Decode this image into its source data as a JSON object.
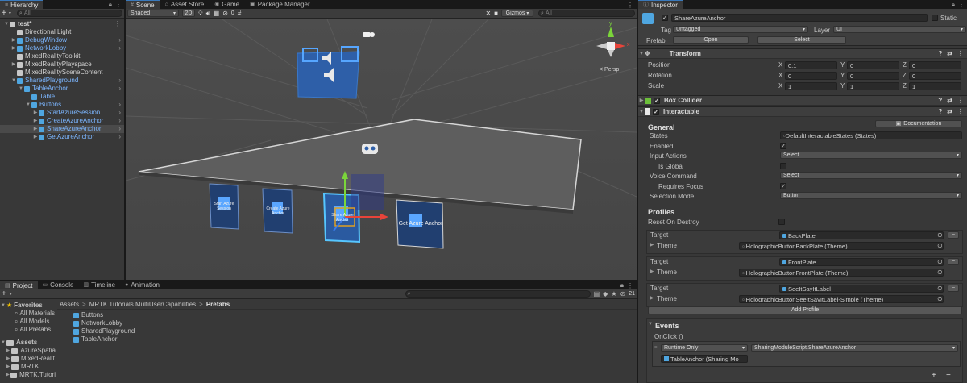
{
  "hierarchy": {
    "tab": "Hierarchy",
    "search_placeholder": "All",
    "items": [
      {
        "label": "test*",
        "blue": false,
        "arrow": "▼",
        "icon": "unity-scene"
      },
      {
        "label": "Directional Light",
        "blue": false,
        "arrow": "",
        "icon": "cube"
      },
      {
        "label": "DebugWindow",
        "blue": true,
        "arrow": "▶",
        "icon": "prefab"
      },
      {
        "label": "NetworkLobby",
        "blue": true,
        "arrow": "▶",
        "icon": "prefab"
      },
      {
        "label": "MixedRealityToolkit",
        "blue": false,
        "arrow": "",
        "icon": "cube"
      },
      {
        "label": "MixedRealityPlayspace",
        "blue": false,
        "arrow": "▶",
        "icon": "cube"
      },
      {
        "label": "MixedRealitySceneContent",
        "blue": false,
        "arrow": "",
        "icon": "cube"
      },
      {
        "label": "SharedPlayground",
        "blue": true,
        "arrow": "▼",
        "icon": "prefab"
      },
      {
        "label": "TableAnchor",
        "blue": true,
        "arrow": "▼",
        "icon": "prefab"
      },
      {
        "label": "Table",
        "blue": true,
        "arrow": "",
        "icon": "prefab"
      },
      {
        "label": "Buttons",
        "blue": true,
        "arrow": "▼",
        "icon": "prefab"
      },
      {
        "label": "StartAzureSession",
        "blue": true,
        "arrow": "▶",
        "icon": "prefab"
      },
      {
        "label": "CreateAzureAnchor",
        "blue": true,
        "arrow": "▶",
        "icon": "prefab"
      },
      {
        "label": "ShareAzureAnchor",
        "blue": true,
        "arrow": "▶",
        "icon": "prefab"
      },
      {
        "label": "GetAzureAnchor",
        "blue": true,
        "arrow": "▶",
        "icon": "prefab"
      }
    ]
  },
  "scene": {
    "tabs": [
      "Scene",
      "Asset Store",
      "Game",
      "Package Manager"
    ],
    "shading": "Shaded",
    "mode_2d": "2D",
    "hidden_count": "0",
    "gizmos": "Gizmos",
    "search_placeholder": "All",
    "persp_label": "< Persp",
    "axis_y": "y",
    "axis_x": "x",
    "panel_texts": [
      "Start Azure Session",
      "Create Azure Anchor",
      "Share Azure Anchor",
      "Get Azure Anchor"
    ]
  },
  "project": {
    "tabs": [
      "Project",
      "Console",
      "Timeline",
      "Animation"
    ],
    "search_placeholder": "",
    "hidden_count": "21",
    "favorites_label": "Favorites",
    "favorites": [
      "All Materials",
      "All Models",
      "All Prefabs"
    ],
    "assets_label": "Assets",
    "assets": [
      "AzureSpatia",
      "MixedRealit",
      "MRTK",
      "MRTK.Tutori"
    ],
    "breadcrumb": [
      "Assets",
      "MRTK.Tutorials.MultiUserCapabilities",
      "Prefabs"
    ],
    "files": [
      "Buttons",
      "NetworkLobby",
      "SharedPlayground",
      "TableAnchor"
    ]
  },
  "inspector": {
    "tab": "Inspector",
    "object_name": "ShareAzureAnchor",
    "static_label": "Static",
    "tag_label": "Tag",
    "tag_value": "Untagged",
    "layer_label": "Layer",
    "layer_value": "UI",
    "prefab_label": "Prefab",
    "open_label": "Open",
    "select_label": "Select",
    "transform": {
      "title": "Transform",
      "rows": [
        {
          "label": "Position",
          "x": "0.1",
          "y": "0",
          "z": "0"
        },
        {
          "label": "Rotation",
          "x": "0",
          "y": "0",
          "z": "0"
        },
        {
          "label": "Scale",
          "x": "1",
          "y": "1",
          "z": "1"
        }
      ]
    },
    "box_collider_title": "Box Collider",
    "interactable_title": "Interactable",
    "general": {
      "heading": "General",
      "doc_label": "Documentation",
      "states_label": "States",
      "states_value": "DefaultInteractableStates (States)",
      "enabled_label": "Enabled",
      "enabled_checked": true,
      "input_actions_label": "Input Actions",
      "input_actions_value": "Select",
      "is_global_label": "Is Global",
      "is_global_checked": false,
      "voice_command_label": "Voice Command",
      "voice_command_value": "Select",
      "requires_focus_label": "Requires Focus",
      "requires_focus_checked": true,
      "selection_mode_label": "Selection Mode",
      "selection_mode_value": "Button"
    },
    "profiles": {
      "heading": "Profiles",
      "reset_label": "Reset On Destroy",
      "target_label": "Target",
      "theme_label": "Theme",
      "items": [
        {
          "target": "BackPlate",
          "theme": "HolographicButtonBackPlate (Theme)"
        },
        {
          "target": "FrontPlate",
          "theme": "HolographicButtonFrontPlate (Theme)"
        },
        {
          "target": "SeeItSayItLabel",
          "theme": "HolographicButtonSeeItSayItLabel-Simple (Theme)"
        }
      ],
      "add_label": "Add Profile"
    },
    "events": {
      "heading": "Events",
      "onclick_label": "OnClick ()",
      "runtime": "Runtime Only",
      "method": "SharingModuleScript.ShareAzureAnchor",
      "object": "TableAnchor (Sharing Mo"
    }
  },
  "colors": {
    "accent_blue": "#3a79bb",
    "prefab_blue": "#7cb6ff",
    "scene_bg": "#474747"
  }
}
